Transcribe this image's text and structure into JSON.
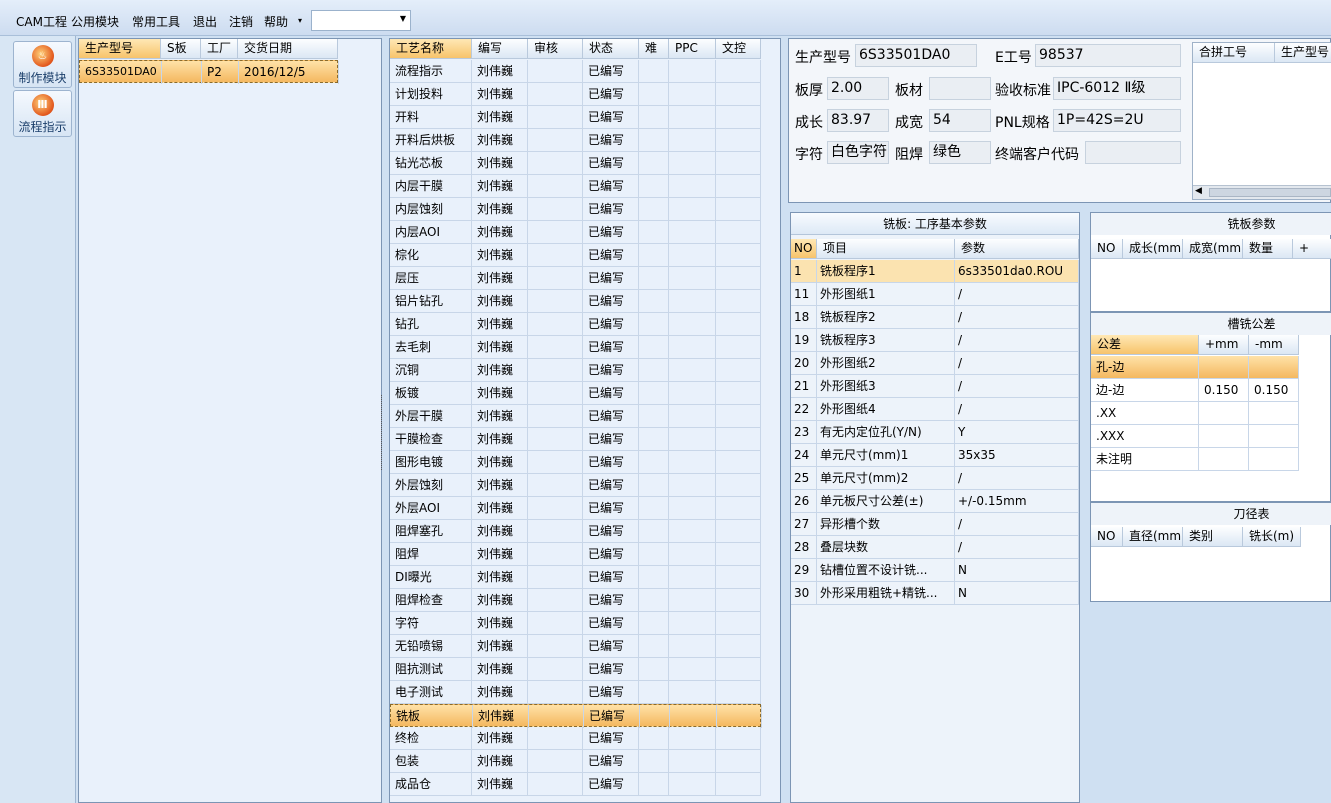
{
  "menu": {
    "items": [
      "CAM工程",
      "公用模块",
      "常用工具",
      "退出",
      "注销",
      "帮助"
    ],
    "dropdown_arrow": "▾",
    "combo_value": ""
  },
  "nav": [
    {
      "label": "制作模块",
      "icon": "flame-icon"
    },
    {
      "label": "流程指示",
      "icon": "flow-icon"
    }
  ],
  "orders": {
    "headers": [
      "生产型号",
      "S板",
      "工厂",
      "交货日期"
    ],
    "rows": [
      [
        "6S33501DA0",
        "",
        "P2",
        "2016/12/5"
      ]
    ]
  },
  "processes": {
    "headers": [
      "工艺名称",
      "编写",
      "审核",
      "状态",
      "难",
      "PPC",
      "文控"
    ],
    "rows": [
      [
        "流程指示",
        "刘伟巍",
        "",
        "已编写"
      ],
      [
        "计划投料",
        "刘伟巍",
        "",
        "已编写"
      ],
      [
        "开料",
        "刘伟巍",
        "",
        "已编写"
      ],
      [
        "开料后烘板",
        "刘伟巍",
        "",
        "已编写"
      ],
      [
        "钻光芯板",
        "刘伟巍",
        "",
        "已编写"
      ],
      [
        "内层干膜",
        "刘伟巍",
        "",
        "已编写"
      ],
      [
        "内层蚀刻",
        "刘伟巍",
        "",
        "已编写"
      ],
      [
        "内层AOI",
        "刘伟巍",
        "",
        "已编写"
      ],
      [
        "棕化",
        "刘伟巍",
        "",
        "已编写"
      ],
      [
        "层压",
        "刘伟巍",
        "",
        "已编写"
      ],
      [
        "铝片钻孔",
        "刘伟巍",
        "",
        "已编写"
      ],
      [
        "钻孔",
        "刘伟巍",
        "",
        "已编写"
      ],
      [
        "去毛刺",
        "刘伟巍",
        "",
        "已编写"
      ],
      [
        "沉铜",
        "刘伟巍",
        "",
        "已编写"
      ],
      [
        "板镀",
        "刘伟巍",
        "",
        "已编写"
      ],
      [
        "外层干膜",
        "刘伟巍",
        "",
        "已编写"
      ],
      [
        "干膜检查",
        "刘伟巍",
        "",
        "已编写"
      ],
      [
        "图形电镀",
        "刘伟巍",
        "",
        "已编写"
      ],
      [
        "外层蚀刻",
        "刘伟巍",
        "",
        "已编写"
      ],
      [
        "外层AOI",
        "刘伟巍",
        "",
        "已编写"
      ],
      [
        "阻焊塞孔",
        "刘伟巍",
        "",
        "已编写"
      ],
      [
        "阻焊",
        "刘伟巍",
        "",
        "已编写"
      ],
      [
        "DI曝光",
        "刘伟巍",
        "",
        "已编写"
      ],
      [
        "阻焊检查",
        "刘伟巍",
        "",
        "已编写"
      ],
      [
        "字符",
        "刘伟巍",
        "",
        "已编写"
      ],
      [
        "无铅喷锡",
        "刘伟巍",
        "",
        "已编写"
      ],
      [
        "阻抗测试",
        "刘伟巍",
        "",
        "已编写"
      ],
      [
        "电子测试",
        "刘伟巍",
        "",
        "已编写"
      ],
      [
        "铣板",
        "刘伟巍",
        "",
        "已编写"
      ],
      [
        "终检",
        "刘伟巍",
        "",
        "已编写"
      ],
      [
        "包装",
        "刘伟巍",
        "",
        "已编写"
      ],
      [
        "成品仓",
        "刘伟巍",
        "",
        "已编写"
      ]
    ],
    "selected": 28
  },
  "info": {
    "model_label": "生产型号",
    "model": "6S33501DA0",
    "e_label": "E工号",
    "e_no": "98537",
    "thick_label": "板厚",
    "thick": "2.00",
    "mat_label": "板材",
    "mat": "",
    "std_label": "验收标准",
    "std": "IPC-6012 Ⅱ级",
    "len_label": "成长",
    "len": "83.97",
    "wid_label": "成宽",
    "wid": "54",
    "pnl_label": "PNL规格",
    "pnl": "1P=42S=2U",
    "char_label": "字符",
    "char": "白色字符",
    "mask_label": "阻焊",
    "mask": "绿色",
    "cust_label": "终端客户代码",
    "cust": ""
  },
  "merge": {
    "headers": [
      "合拼工号",
      "生产型号"
    ]
  },
  "params": {
    "title": "铣板: 工序基本参数",
    "headers": [
      "NO",
      "项目",
      "参数"
    ],
    "rows": [
      [
        "1",
        "铣板程序1",
        "6s33501da0.ROU"
      ],
      [
        "11",
        "外形图纸1",
        "/"
      ],
      [
        "18",
        "铣板程序2",
        "/"
      ],
      [
        "19",
        "铣板程序3",
        "/"
      ],
      [
        "20",
        "外形图纸2",
        "/"
      ],
      [
        "21",
        "外形图纸3",
        "/"
      ],
      [
        "22",
        "外形图纸4",
        "/"
      ],
      [
        "23",
        "有无内定位孔(Y/N)",
        "Y"
      ],
      [
        "24",
        "单元尺寸(mm)1",
        "35x35"
      ],
      [
        "25",
        "单元尺寸(mm)2",
        "/"
      ],
      [
        "26",
        "单元板尺寸公差(±)",
        "+/-0.15mm"
      ],
      [
        "27",
        "异形槽个数",
        "/"
      ],
      [
        "28",
        "叠层块数",
        "/"
      ],
      [
        "29",
        "钻槽位置不设计铣...",
        "N"
      ],
      [
        "30",
        "外形采用粗铣+精铣...",
        "N"
      ]
    ]
  },
  "mill": {
    "title": "铣板参数",
    "headers": [
      "NO",
      "成长(mm)",
      "成宽(mm)",
      "数量",
      "+"
    ]
  },
  "tol": {
    "title": "槽铣公差",
    "headers": [
      "公差",
      "+mm",
      "-mm"
    ],
    "rows": [
      [
        "孔-边",
        "",
        ""
      ],
      [
        "边-边",
        "0.150",
        "0.150"
      ],
      [
        ".XX",
        "",
        ""
      ],
      [
        ".XXX",
        "",
        ""
      ],
      [
        "未注明",
        "",
        ""
      ]
    ]
  },
  "tools": {
    "title": "刀径表",
    "headers": [
      "NO",
      "直径(mm)",
      "类别",
      "铣长(m)"
    ]
  }
}
